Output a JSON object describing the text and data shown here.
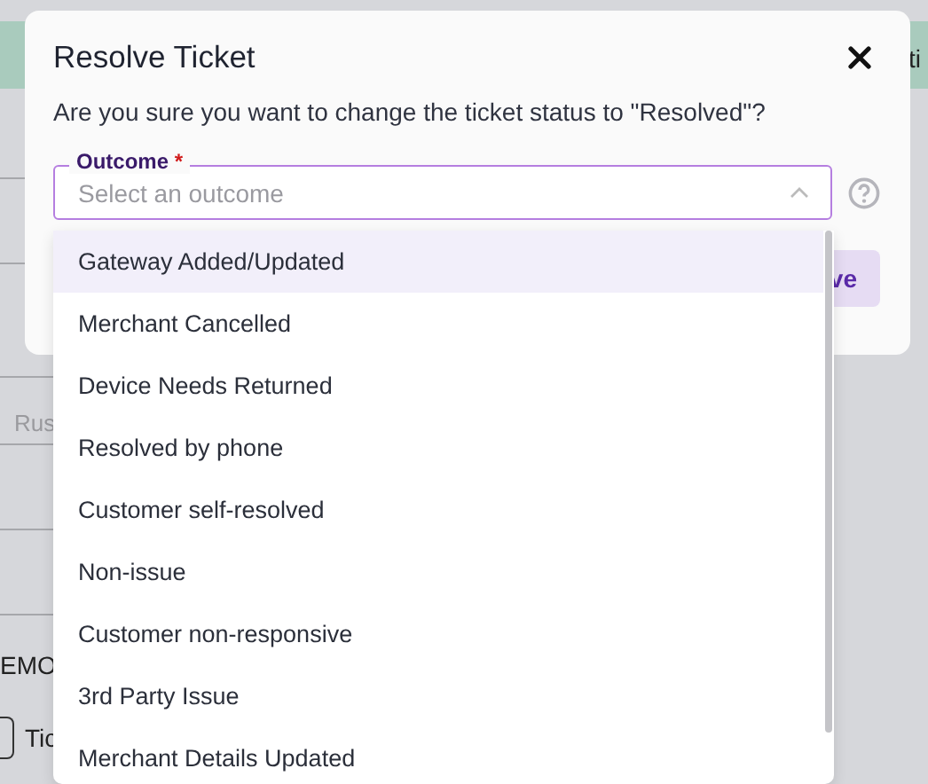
{
  "background": {
    "fragments": [
      {
        "kind": "cell",
        "text": "Rus"
      },
      {
        "kind": "label",
        "text": "EMO"
      },
      {
        "kind": "checkbox",
        "text": "Tic",
        "checked": false
      },
      {
        "kind": "header",
        "text": "ti"
      }
    ]
  },
  "dialog": {
    "title": "Resolve Ticket",
    "message": "Are you sure you want to change the ticket status to \"Resolved\"?",
    "field": {
      "label": "Outcome",
      "required_mark": "*",
      "placeholder": "Select an outcome",
      "expanded": true
    },
    "confirm_button": "ve"
  },
  "options": [
    {
      "label": "Gateway Added/Updated",
      "selected": true
    },
    {
      "label": "Merchant Cancelled",
      "selected": false
    },
    {
      "label": "Device Needs Returned",
      "selected": false
    },
    {
      "label": "Resolved by phone",
      "selected": false
    },
    {
      "label": "Customer self-resolved",
      "selected": false
    },
    {
      "label": "Non-issue",
      "selected": false
    },
    {
      "label": "Customer non-responsive",
      "selected": false
    },
    {
      "label": "3rd Party Issue",
      "selected": false
    },
    {
      "label": "Merchant Details Updated",
      "selected": false
    }
  ]
}
